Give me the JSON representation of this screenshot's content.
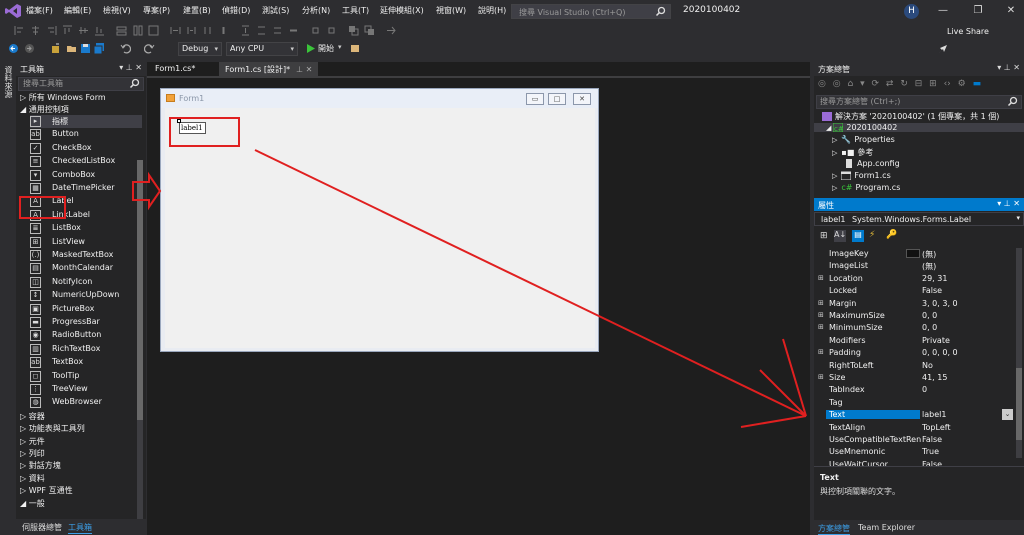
{
  "menubar": {
    "items": [
      "檔案(F)",
      "編輯(E)",
      "檢視(V)",
      "專案(P)",
      "建置(B)",
      "偵錯(D)",
      "測試(S)",
      "分析(N)",
      "工具(T)",
      "延伸模組(X)",
      "視窗(W)",
      "說明(H)"
    ],
    "search_placeholder": "搜尋 Visual Studio (Ctrl+Q)",
    "solution_name": "2020100402",
    "avatar_initial": "H",
    "window_buttons": [
      "—",
      "❐",
      "✕"
    ]
  },
  "toolbar": {
    "config": "Debug",
    "platform": "Any CPU",
    "start_label": "開始",
    "live_share": "Live Share"
  },
  "left_tab": {
    "label": "資料來源"
  },
  "toolbox": {
    "title": "工具箱",
    "search_placeholder": "搜尋工具箱",
    "groups_top": [
      "▷ 所有 Windows Form",
      "◢ 通用控制項"
    ],
    "items": [
      {
        "label": "指標",
        "icon": "▸"
      },
      {
        "label": "Button",
        "icon": "ab"
      },
      {
        "label": "CheckBox",
        "icon": "✓"
      },
      {
        "label": "CheckedListBox",
        "icon": "≡"
      },
      {
        "label": "ComboBox",
        "icon": "▾"
      },
      {
        "label": "DateTimePicker",
        "icon": "▦"
      },
      {
        "label": "Label",
        "icon": "A"
      },
      {
        "label": "LinkLabel",
        "icon": "A"
      },
      {
        "label": "ListBox",
        "icon": "≣"
      },
      {
        "label": "ListView",
        "icon": "⊞"
      },
      {
        "label": "MaskedTextBox",
        "icon": "(.)"
      },
      {
        "label": "MonthCalendar",
        "icon": "▤"
      },
      {
        "label": "NotifyIcon",
        "icon": "◫"
      },
      {
        "label": "NumericUpDown",
        "icon": "↕"
      },
      {
        "label": "PictureBox",
        "icon": "▣"
      },
      {
        "label": "ProgressBar",
        "icon": "▬"
      },
      {
        "label": "RadioButton",
        "icon": "◉"
      },
      {
        "label": "RichTextBox",
        "icon": "▥"
      },
      {
        "label": "TextBox",
        "icon": "ab"
      },
      {
        "label": "ToolTip",
        "icon": "◻"
      },
      {
        "label": "TreeView",
        "icon": "⋮"
      },
      {
        "label": "WebBrowser",
        "icon": "◍"
      }
    ],
    "groups_bottom": [
      "▷ 容器",
      "▷ 功能表與工具列",
      "▷ 元件",
      "▷ 列印",
      "▷ 對話方塊",
      "▷ 資料",
      "▷ WPF 互通性",
      "◢ 一般"
    ],
    "bottom_tabs": [
      "伺服器總管",
      "工具箱"
    ]
  },
  "editor": {
    "tabs": [
      "Form1.cs*",
      "Form1.cs [設計]*"
    ],
    "form_title": "Form1",
    "label_text": "label1"
  },
  "solution_explorer": {
    "title": "方案總管",
    "search_placeholder": "搜尋方案總管 (Ctrl+;)",
    "tree": [
      {
        "label": "解決方案 '2020100402' (1 個專案，共 1 個)",
        "indent": 0
      },
      {
        "label": "2020100402",
        "indent": 1
      },
      {
        "label": "Properties",
        "indent": 2
      },
      {
        "label": "參考",
        "indent": 2
      },
      {
        "label": "App.config",
        "indent": 2
      },
      {
        "label": "Form1.cs",
        "indent": 2
      },
      {
        "label": "Program.cs",
        "indent": 2
      }
    ]
  },
  "properties": {
    "title": "屬性",
    "object_name": "label1",
    "object_type": "System.Windows.Forms.Label",
    "rows": [
      {
        "name": "ImageKey",
        "value": "(無)",
        "expand": ""
      },
      {
        "name": "ImageList",
        "value": "(無)",
        "expand": ""
      },
      {
        "name": "Location",
        "value": "29, 31",
        "expand": "⊞"
      },
      {
        "name": "Locked",
        "value": "False",
        "expand": ""
      },
      {
        "name": "Margin",
        "value": "3, 0, 3, 0",
        "expand": "⊞"
      },
      {
        "name": "MaximumSize",
        "value": "0, 0",
        "expand": "⊞"
      },
      {
        "name": "MinimumSize",
        "value": "0, 0",
        "expand": "⊞"
      },
      {
        "name": "Modifiers",
        "value": "Private",
        "expand": ""
      },
      {
        "name": "Padding",
        "value": "0, 0, 0, 0",
        "expand": "⊞"
      },
      {
        "name": "RightToLeft",
        "value": "No",
        "expand": ""
      },
      {
        "name": "Size",
        "value": "41, 15",
        "expand": "⊞"
      },
      {
        "name": "TabIndex",
        "value": "0",
        "expand": ""
      },
      {
        "name": "Tag",
        "value": "",
        "expand": ""
      },
      {
        "name": "Text",
        "value": "label1",
        "expand": ""
      },
      {
        "name": "TextAlign",
        "value": "TopLeft",
        "expand": ""
      },
      {
        "name": "UseCompatibleTextRend",
        "value": "False",
        "expand": ""
      },
      {
        "name": "UseMnemonic",
        "value": "True",
        "expand": ""
      },
      {
        "name": "UseWaitCursor",
        "value": "False",
        "expand": ""
      }
    ],
    "selected_row": "Text",
    "desc_title": "Text",
    "desc_text": "與控制項關聯的文字。",
    "bottom_tabs": [
      "方案總管",
      "Team Explorer"
    ]
  },
  "annotation_color": "#e02020"
}
